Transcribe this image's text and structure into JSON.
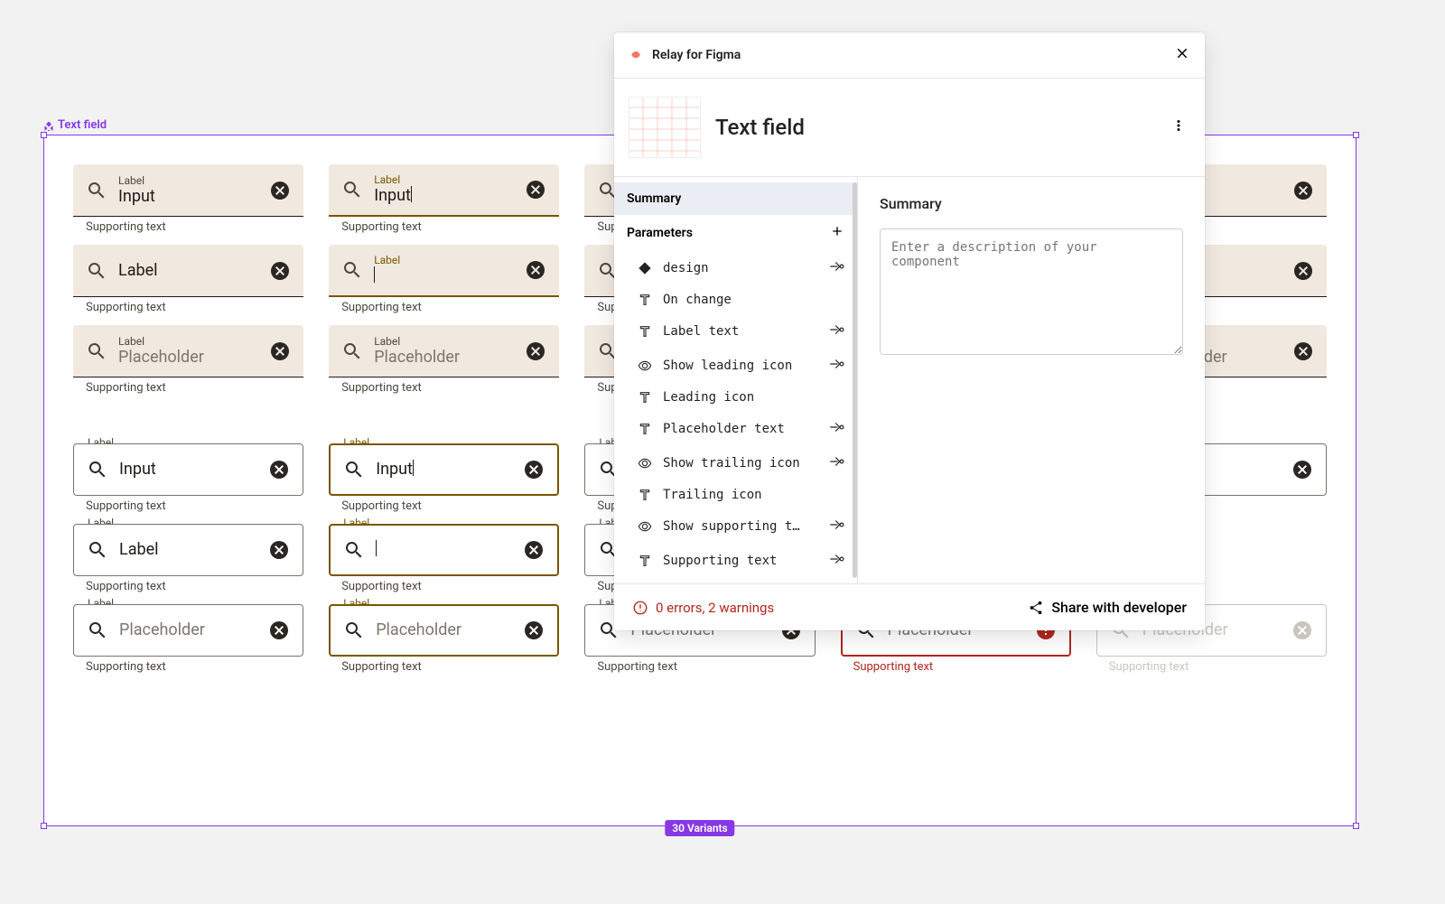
{
  "frame": {
    "label": "Text field",
    "variants_badge": "30 Variants"
  },
  "strings": {
    "label": "Label",
    "input": "Input",
    "placeholder": "Placeholder",
    "supporting": "Supporting text"
  },
  "panel": {
    "title": "Relay for Figma",
    "component_name": "Text field",
    "nav": {
      "summary": "Summary",
      "parameters": "Parameters",
      "items": [
        {
          "icon": "diamond",
          "label": "design",
          "bind": true
        },
        {
          "icon": "text",
          "label": "On change",
          "bind": false
        },
        {
          "icon": "text",
          "label": "Label text",
          "bind": true
        },
        {
          "icon": "eye",
          "label": "Show leading icon",
          "bind": true
        },
        {
          "icon": "text",
          "label": "Leading icon",
          "bind": false
        },
        {
          "icon": "text",
          "label": "Placeholder text",
          "bind": true
        },
        {
          "icon": "eye",
          "label": "Show trailing icon",
          "bind": true
        },
        {
          "icon": "text",
          "label": "Trailing icon",
          "bind": false
        },
        {
          "icon": "eye",
          "label": "Show supporting t…",
          "bind": true
        },
        {
          "icon": "text",
          "label": "Supporting text",
          "bind": true
        }
      ]
    },
    "summary_heading": "Summary",
    "description_placeholder": "Enter a description of your component",
    "footer": {
      "status": "0 errors, 2 warnings",
      "share": "Share with developer"
    }
  }
}
